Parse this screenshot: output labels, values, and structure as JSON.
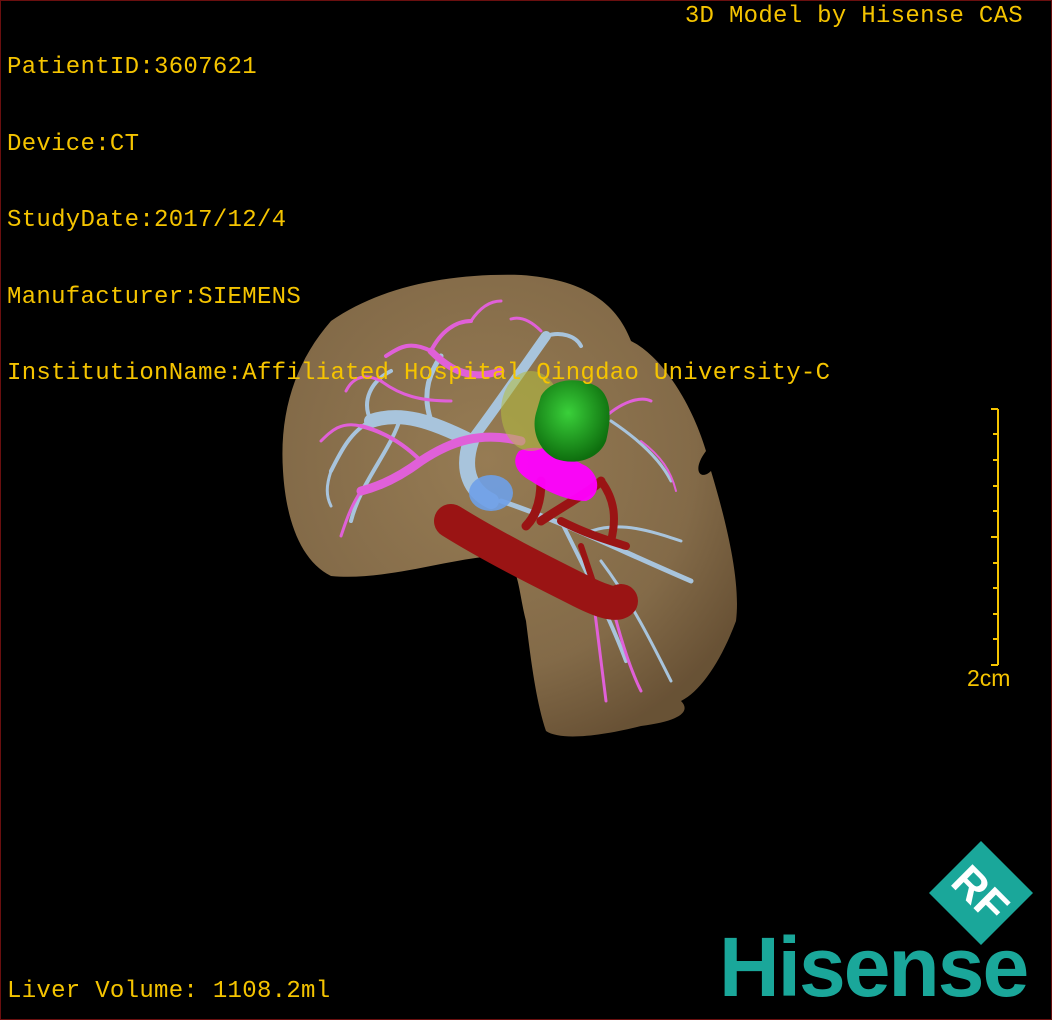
{
  "header": {
    "patient_id": "PatientID:3607621",
    "device": "Device:CT",
    "study_date": "StudyDate:2017/12/4",
    "manufacturer": "Manufacturer:SIEMENS",
    "institution": "InstitutionName:Affiliated Hospital Qingdao University-C"
  },
  "credit": "3D Model by Hisense CAS",
  "scale_bar": {
    "label": "2cm"
  },
  "footer": {
    "liver_volume": "Liver Volume: 1108.2ml"
  },
  "logo": {
    "badge_text": "RF",
    "wordmark": "Hisense",
    "color": "#1aa79a"
  },
  "colors": {
    "overlay_text": "#f5c400",
    "liver": "#8c7350",
    "portal_vein": "#e060d8",
    "hepatic_vein": "#a8c4dc",
    "artery_ivc": "#9a1414",
    "gallbladder": "#1f9a1f",
    "tumor_magenta": "#ff00ff",
    "frame_border": "#6a0f0f"
  }
}
